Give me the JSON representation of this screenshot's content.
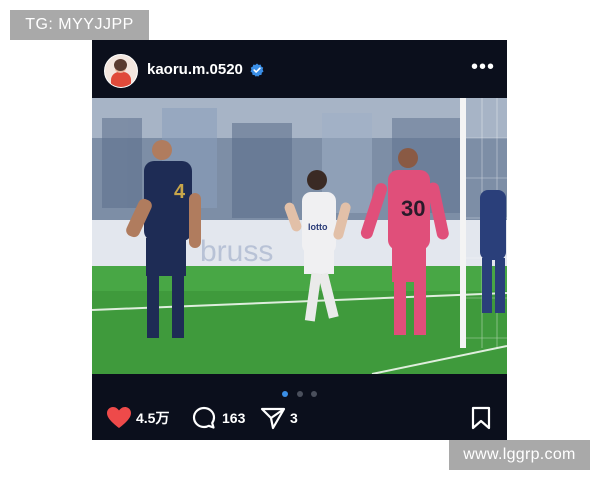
{
  "watermarks": {
    "top_left": "TG: MYYJJPP",
    "bottom_right": "www.lggrp.com"
  },
  "post": {
    "username": "kaoru.m.0520",
    "verified": true,
    "avatar_icon": "profile-avatar",
    "more_icon": "more-horizontal-icon",
    "photo": {
      "description_icon": "soccer-match-photo",
      "banner_text": "bruss",
      "jersey_left": "4",
      "jersey_goalkeeper": "30",
      "sponsor_text": "lotto"
    },
    "carousel": {
      "total": 3,
      "active_index": 0
    },
    "actions": {
      "likes": "4.5万",
      "comments": "163",
      "shares": "3"
    },
    "colors": {
      "background": "#0b0f1c",
      "like": "#ee4a4a",
      "verified": "#3a8ee6",
      "carousel_active": "#3a8ee6"
    }
  }
}
